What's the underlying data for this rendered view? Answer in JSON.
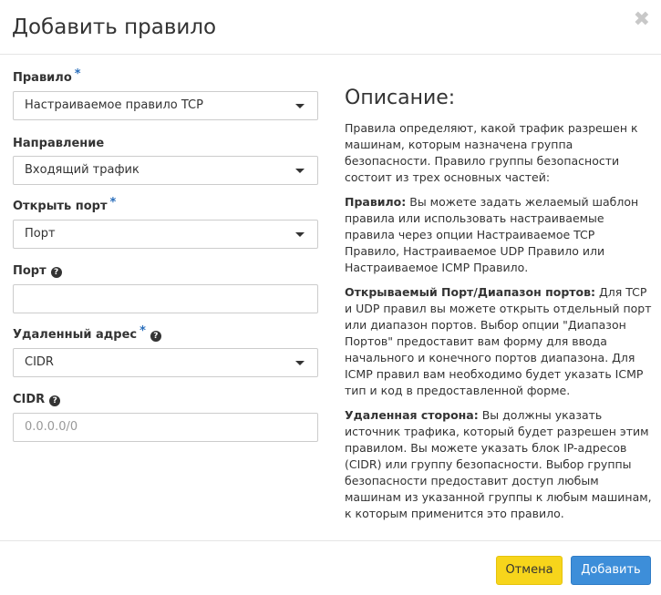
{
  "modal": {
    "title": "Добавить правило",
    "close_glyph": "✖"
  },
  "form": {
    "rule": {
      "label": "Правило",
      "required": "*",
      "value": "Настраиваемое правило TCP"
    },
    "direction": {
      "label": "Направление",
      "value": "Входящий трафик"
    },
    "open_port": {
      "label": "Открыть порт",
      "required": "*",
      "value": "Порт"
    },
    "port": {
      "label": "Порт",
      "value": "",
      "placeholder": ""
    },
    "remote": {
      "label": "Удаленный адрес",
      "required": "*",
      "value": "CIDR"
    },
    "cidr": {
      "label": "CIDR",
      "value": "",
      "placeholder": "0.0.0.0/0"
    }
  },
  "description": {
    "heading": "Описание:",
    "intro": "Правила определяют, какой трафик разрешен к машинам, которым назначена группа безопасности. Правило группы безопасности состоит из трех основных частей:",
    "rule_title": "Правило:",
    "rule_text": "Вы можете задать желаемый шаблон правила или использовать настраиваемые правила через опции Настраиваемое TCP Правило, Настраиваемое UDP Правило или Настраиваемое ICMP Правило.",
    "port_title": "Открываемый Порт/Диапазон портов:",
    "port_text": "Для TCP и UDP правил вы можете открыть отдельный порт или диапазон портов. Выбор опции \"Диапазон Портов\" предоставит вам форму для ввода начального и конечного портов диапазона. Для ICMP правил вам необходимо будет указать ICMP тип и код в предоставленной форме.",
    "remote_title": "Удаленная сторона:",
    "remote_text": "Вы должны указать источник трафика, который будет разрешен этим правилом. Вы можете указать блок IP-адресов (CIDR) или группу безопасности. Выбор группы безопасности предоставит доступ любым машинам из указанной группы к любым машинам, к которым применится это правило."
  },
  "footer": {
    "cancel_label": "Отмена",
    "submit_label": "Добавить"
  },
  "colors": {
    "cancel_bg": "#f7d51b",
    "submit_bg": "#3d8ed9",
    "required_marker": "#2a6ebb"
  },
  "icons": {
    "help": "question-circle-icon",
    "close": "close-icon",
    "caret": "caret-down-icon"
  }
}
